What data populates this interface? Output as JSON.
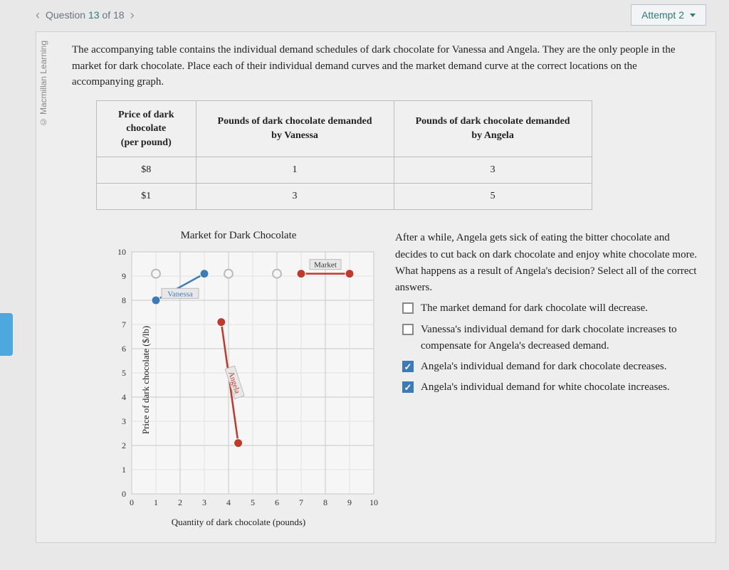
{
  "nav": {
    "prev": "‹",
    "next": "›",
    "question_label": "Question",
    "current": "13",
    "of": "of",
    "total": "18"
  },
  "attempt": "Attempt 2",
  "copyright": "© Macmillan Learning",
  "prompt": "The accompanying table contains the individual demand schedules of dark chocolate for Vanessa and Angela. They are the only people in the market for dark chocolate. Place each of their individual demand curves and the market demand curve at the correct locations on the accompanying graph.",
  "table": {
    "headers": [
      "Price of dark chocolate (per pound)",
      "Pounds of dark chocolate demanded by Vanessa",
      "Pounds of dark chocolate demanded by Angela"
    ],
    "rows": [
      [
        "$8",
        "1",
        "3"
      ],
      [
        "$1",
        "3",
        "5"
      ]
    ]
  },
  "chart_data": {
    "type": "line",
    "title": "Market for Dark Chocolate",
    "xlabel": "Quantity of dark chocolate (pounds)",
    "ylabel": "Price of dark chocolate ($/lb)",
    "xlim": [
      0,
      10
    ],
    "ylim": [
      0,
      10
    ],
    "targets": [
      {
        "x": 1,
        "y": 9.1
      },
      {
        "x": 4,
        "y": 9.1
      },
      {
        "x": 6,
        "y": 9.1
      }
    ],
    "series": [
      {
        "name": "Vanessa",
        "color": "#3d7ab8",
        "points": [
          {
            "x": 1,
            "y": 8
          },
          {
            "x": 3,
            "y": 9.1
          }
        ]
      },
      {
        "name": "Angela",
        "color": "#c0392b",
        "points": [
          {
            "x": 3.7,
            "y": 7.1
          },
          {
            "x": 4.4,
            "y": 2.1
          }
        ]
      },
      {
        "name": "Market",
        "color": "#c0392b",
        "points": [
          {
            "x": 7,
            "y": 9.1
          },
          {
            "x": 9,
            "y": 9.1
          }
        ]
      }
    ]
  },
  "followup": {
    "text": "After a while, Angela gets sick of eating the bitter chocolate and decides to cut back on dark chocolate and enjoy white chocolate more. What happens as a result of Angela's decision? Select all of the correct answers.",
    "options": [
      {
        "label": "The market demand for dark chocolate will decrease.",
        "checked": false
      },
      {
        "label": "Vanessa's individual demand for dark chocolate increases to compensate for Angela's decreased demand.",
        "checked": false
      },
      {
        "label": "Angela's individual demand for dark chocolate decreases.",
        "checked": true
      },
      {
        "label": "Angela's individual demand for white chocolate increases.",
        "checked": true
      }
    ]
  }
}
